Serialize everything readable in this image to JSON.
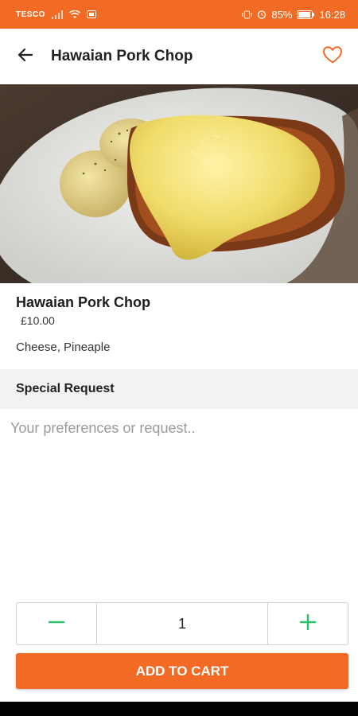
{
  "status_bar": {
    "carrier": "TESCO",
    "battery": "85%",
    "time": "16:28",
    "icons": [
      "signal-icon",
      "wifi-icon",
      "data-icon",
      "vibrate-icon",
      "alarm-icon",
      "battery-icon"
    ]
  },
  "app_bar": {
    "title": "Hawaian Pork Chop",
    "back_icon": "arrow-left-icon",
    "favorite_icon": "heart-outline-icon"
  },
  "product": {
    "image": "pork-chop-photo",
    "name": "Hawaian Pork Chop",
    "price": "£10.00",
    "description": "Cheese, Pineaple"
  },
  "special_request": {
    "header": "Special Request",
    "placeholder": "Your preferences or request..",
    "value": ""
  },
  "quantity": {
    "value": "1",
    "decrement_icon": "minus-icon",
    "increment_icon": "plus-icon"
  },
  "add_to_cart": {
    "label": "ADD TO CART"
  },
  "colors": {
    "accent": "#F26A23",
    "stepper_icons": "#2BC26A",
    "section_bg": "#f2f2f2"
  }
}
